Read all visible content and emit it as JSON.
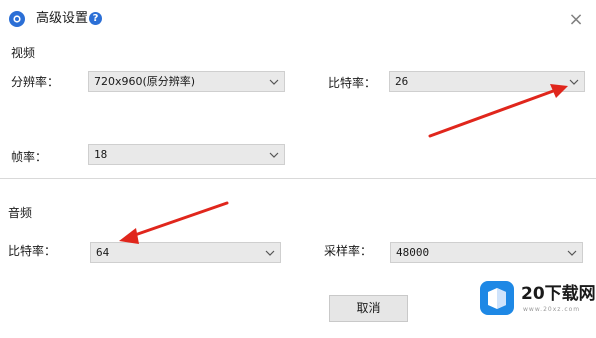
{
  "dialog": {
    "title": "高级设置",
    "help_icon": "?",
    "close_icon": "×"
  },
  "video": {
    "section_title": "视频",
    "resolution": {
      "label": "分辨率：",
      "value": "720x960(原分辨率)"
    },
    "bitrate": {
      "label": "比特率：",
      "value": "26"
    },
    "framerate": {
      "label": "帧率：",
      "value": "18"
    }
  },
  "audio": {
    "section_title": "音频",
    "bitrate": {
      "label": "比特率：",
      "value": "64"
    },
    "samplerate": {
      "label": "采样率：",
      "value": "48000"
    }
  },
  "actions": {
    "cancel_label": "取消"
  },
  "watermark": {
    "brand": "20下载网",
    "url": "www.20xz.com"
  },
  "colors": {
    "arrow": "#e0261c",
    "accent": "#2b6fd6"
  },
  "icons": {
    "app": "gear-icon",
    "help": "help-icon",
    "close": "close-icon",
    "dropdown": "chevron-down-icon"
  }
}
